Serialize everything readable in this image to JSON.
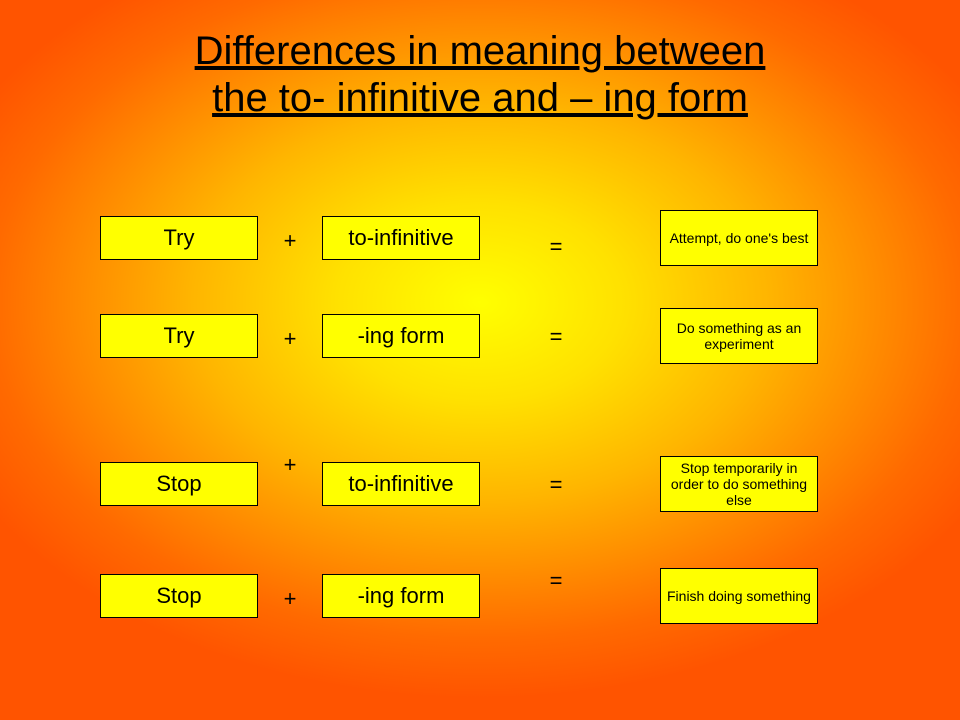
{
  "title_line1": "Differences in meaning between",
  "title_line2": "the to- infinitive and – ing form",
  "rows": [
    {
      "verb": "Try",
      "form": "to-infinitive",
      "meaning": "Attempt, do one's best"
    },
    {
      "verb": "Try",
      "form": "-ing form",
      "meaning": "Do something as an experiment"
    },
    {
      "verb": "Stop",
      "form": "to-infinitive",
      "meaning": "Stop temporarily in order to do something else"
    },
    {
      "verb": "Stop",
      "form": "-ing form",
      "meaning": "Finish doing something"
    }
  ],
  "symbols": {
    "plus": "+",
    "equals": "="
  }
}
